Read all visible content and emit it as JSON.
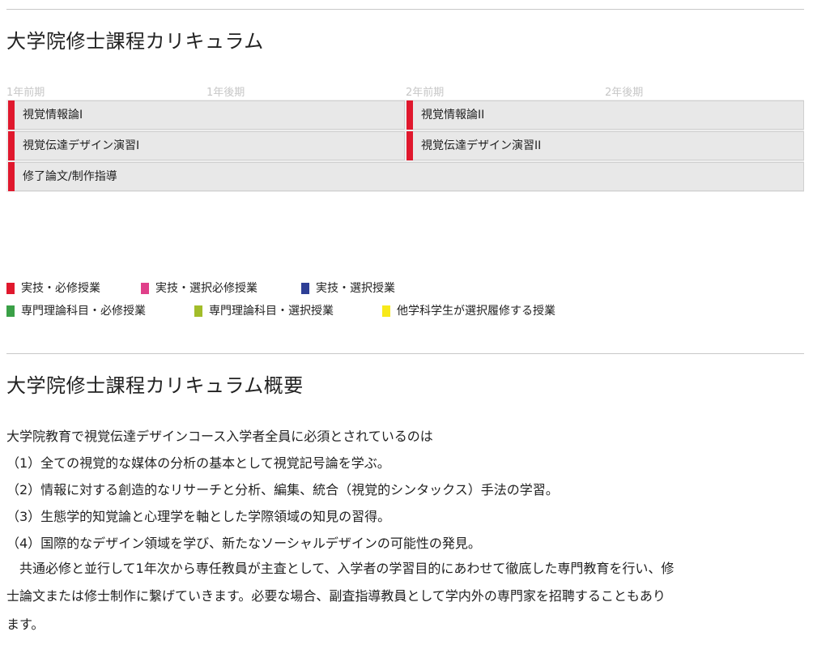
{
  "curriculum": {
    "title": "大学院修士課程カリキュラム",
    "terms": [
      "1年前期",
      "1年後期",
      "2年前期",
      "2年後期"
    ],
    "courses": [
      {
        "name": "視覚情報論I",
        "color": "#e0182d"
      },
      {
        "name": "視覚情報論II",
        "color": "#e0182d"
      },
      {
        "name": "視覚伝達デザイン演習I",
        "color": "#e0182d"
      },
      {
        "name": "視覚伝達デザイン演習II",
        "color": "#e0182d"
      },
      {
        "name": "修了論文/制作指導",
        "color": "#e0182d"
      }
    ]
  },
  "legend": [
    {
      "label": "実技・必修授業",
      "color": "#e0182d"
    },
    {
      "label": "実技・選択必修授業",
      "color": "#e0408a"
    },
    {
      "label": "実技・選択授業",
      "color": "#2e3f96"
    },
    {
      "label": "専門理論科目・必修授業",
      "color": "#3aa047"
    },
    {
      "label": "専門理論科目・選択授業",
      "color": "#a2bd2a"
    },
    {
      "label": "他学科学生が選択履修する授業",
      "color": "#f7e91a"
    }
  ],
  "overview": {
    "title": "大学院修士課程カリキュラム概要",
    "intro": "大学院教育で視覚伝達デザインコース入学者全員に必須とされているのは",
    "items": [
      "（1）全ての視覚的な媒体の分析の基本として視覚記号論を学ぶ。",
      "（2）情報に対する創造的なリサーチと分析、編集、統合（視覚的シンタックス）手法の学習。",
      "（3）生態学的知覚論と心理学を軸とした学際領域の知見の習得。",
      "（4）国際的なデザイン領域を学び、新たなソーシャルデザインの可能性の発見。"
    ],
    "closing_lines": [
      "　共通必修と並行して1年次から専任教員が主査として、入学者の学習目的にあわせて徹底した専門教育を行い、修",
      "士論文または修士制作に繋げていきます。必要な場合、副査指導教員として学内外の専門家を招聘することもあり",
      "ます。"
    ]
  }
}
